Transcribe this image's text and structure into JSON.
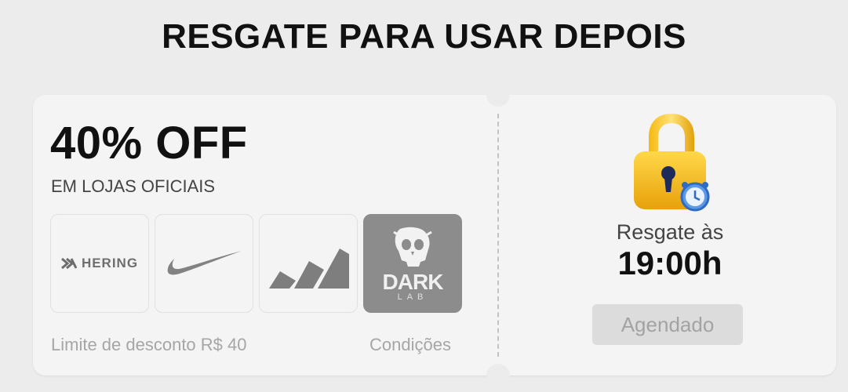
{
  "page": {
    "heading": "RESGATE PARA USAR DEPOIS"
  },
  "coupon": {
    "title": "40% OFF",
    "subtitle": "EM LOJAS OFICIAIS",
    "brands": [
      {
        "name": "HERING",
        "icon": "hering-logo"
      },
      {
        "name": "Nike",
        "icon": "nike-swoosh-logo"
      },
      {
        "name": "adidas",
        "icon": "adidas-logo"
      },
      {
        "name": "DARK LAB",
        "icon": "dark-lab-skull-logo",
        "text_main": "DARK",
        "text_sub": "LAB"
      }
    ],
    "limit_text": "Limite de desconto R$ 40",
    "conditions_label": "Condições"
  },
  "redeem": {
    "icon": "padlock-alarm-clock-icon",
    "label": "Resgate às",
    "time": "19:00h",
    "button_label": "Agendado"
  }
}
